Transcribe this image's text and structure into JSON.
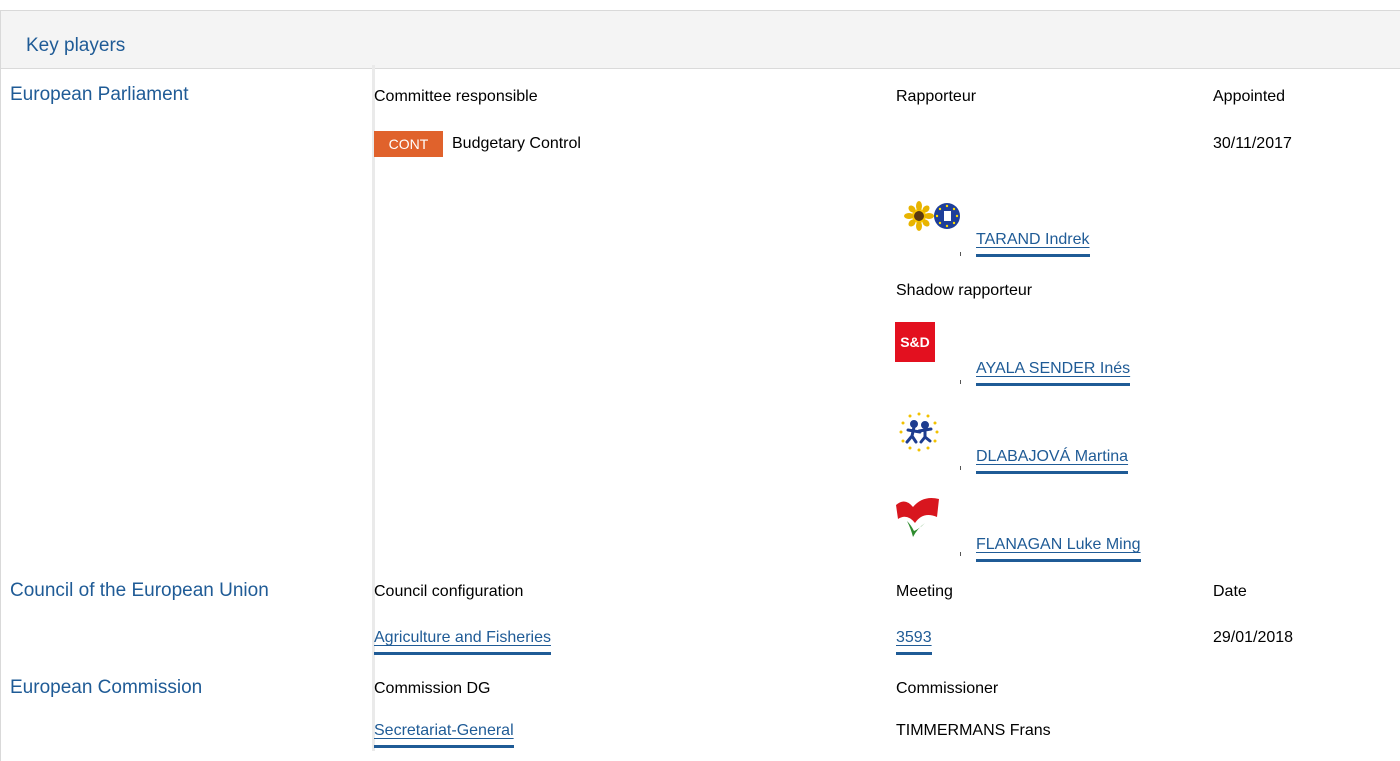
{
  "panel": {
    "title": "Key players"
  },
  "ep": {
    "name": "European Parliament",
    "committee_header": "Committee responsible",
    "rapporteur_header": "Rapporteur",
    "appointed_header": "Appointed",
    "committee_badge": "CONT",
    "committee_name": "Budgetary Control",
    "appointed_date": "30/11/2017",
    "rapporteur": {
      "name": "TARAND Indrek",
      "group_logo": "greens-efa-logo"
    },
    "shadow_header": "Shadow rapporteur",
    "shadows": [
      {
        "name": "AYALA SENDER Inés",
        "group_logo": "s-and-d-logo",
        "logo_text": "S&D"
      },
      {
        "name": "DLABAJOVÁ Martina",
        "group_logo": "alde-logo"
      },
      {
        "name": "FLANAGAN Luke Ming",
        "group_logo": "gue-ngl-logo"
      }
    ]
  },
  "council": {
    "name": "Council of the European Union",
    "config_header": "Council configuration",
    "meeting_header": "Meeting",
    "date_header": "Date",
    "config_value": "Agriculture and Fisheries",
    "meeting_value": "3593",
    "date_value": "29/01/2018"
  },
  "commission": {
    "name": "European Commission",
    "dg_header": "Commission DG",
    "commissioner_header": "Commissioner",
    "dg_value": "Secretariat-General",
    "commissioner_value": "TIMMERMANS Frans"
  },
  "colors": {
    "accent": "#1f5b96",
    "badge": "#e0622c",
    "s_and_d": "#e3101f"
  }
}
